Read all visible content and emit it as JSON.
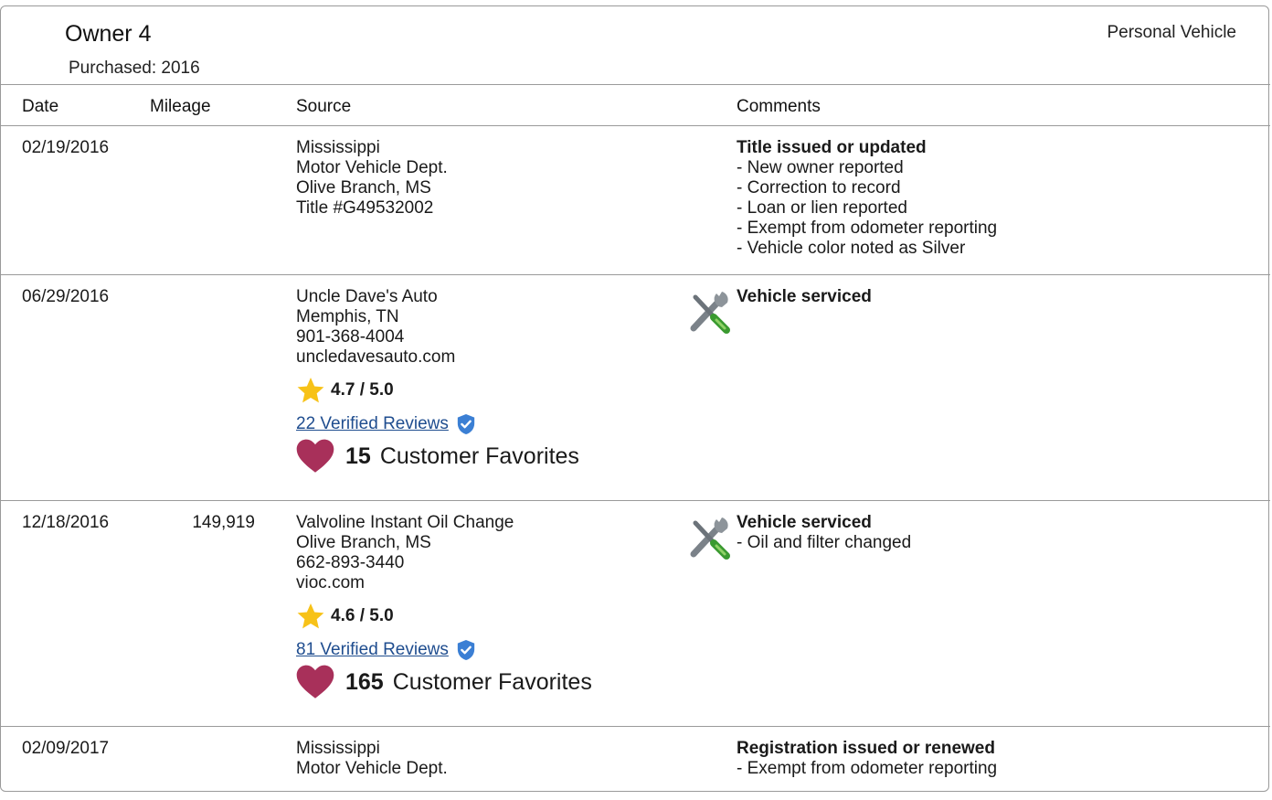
{
  "owner": {
    "title": "Owner 4",
    "purchased": "Purchased: 2016",
    "vehicle_type": "Personal Vehicle"
  },
  "columns": {
    "date": "Date",
    "mileage": "Mileage",
    "source": "Source",
    "comments": "Comments"
  },
  "records": [
    {
      "date": "02/19/2016",
      "mileage": "",
      "source": [
        "Mississippi",
        "Motor Vehicle Dept.",
        "Olive Branch, MS",
        "Title #G49532002"
      ],
      "comment_title": "Title issued or updated",
      "comment_items": [
        "New owner reported",
        "Correction to record",
        "Loan or lien reported",
        "Exempt from odometer reporting",
        "Vehicle color noted as Silver"
      ]
    },
    {
      "date": "06/29/2016",
      "mileage": "",
      "source": [
        "Uncle Dave's Auto",
        "Memphis, TN",
        "901-368-4004",
        "uncledavesauto.com"
      ],
      "rating": "4.7 / 5.0",
      "reviews": "22 Verified Reviews",
      "favorites_count": "15",
      "favorites_label": "Customer Favorites",
      "comment_title": "Vehicle serviced",
      "comment_items": []
    },
    {
      "date": "12/18/2016",
      "mileage": "149,919",
      "source": [
        "Valvoline Instant Oil Change",
        "Olive Branch, MS",
        "662-893-3440",
        "vioc.com"
      ],
      "rating": "4.6 / 5.0",
      "reviews": "81 Verified Reviews",
      "favorites_count": "165",
      "favorites_label": "Customer Favorites",
      "comment_title": "Vehicle serviced",
      "comment_items": [
        "Oil and filter changed"
      ]
    },
    {
      "date": "02/09/2017",
      "mileage": "",
      "source": [
        "Mississippi",
        "Motor Vehicle Dept."
      ],
      "comment_title": "Registration issued or renewed",
      "comment_items": [
        "Exempt from odometer reporting"
      ]
    }
  ],
  "icons": {
    "service": "wrench-screwdriver-icon",
    "rating": "star-icon",
    "verified": "verified-shield-icon",
    "favorites": "heart-icon"
  },
  "colors": {
    "star": "#f7c218",
    "heart": "#a8305a",
    "link": "#1f4d8f",
    "shield": "#3b7fd4"
  }
}
